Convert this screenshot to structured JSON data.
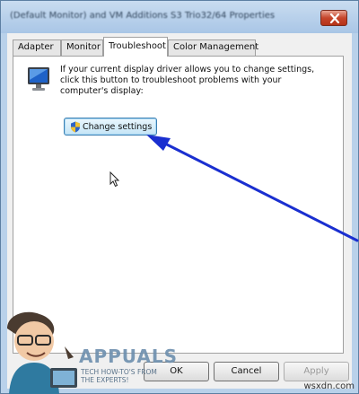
{
  "window": {
    "title": "(Default Monitor) and VM Additions S3 Trio32/64 Properties"
  },
  "tabs": [
    {
      "label": "Adapter",
      "active": false
    },
    {
      "label": "Monitor",
      "active": false
    },
    {
      "label": "Troubleshoot",
      "active": true
    },
    {
      "label": "Color Management",
      "active": false
    }
  ],
  "troubleshoot": {
    "description": "If your current display driver allows you to change settings, click this button to troubleshoot problems with your computer's display:",
    "change_settings_label": "Change settings"
  },
  "footer": {
    "ok_label": "OK",
    "cancel_label": "Cancel",
    "apply_label": "Apply"
  },
  "overlay": {
    "arrow_color": "#1a2fd0"
  },
  "branding": {
    "logo_name": "APPUALS",
    "tagline": "TECH HOW-TO'S FROM THE EXPERTS!",
    "watermark": "wsxdn.com"
  },
  "icons": [
    "close-icon",
    "monitor-icon",
    "uac-shield-icon",
    "mouse-cursor-icon"
  ]
}
